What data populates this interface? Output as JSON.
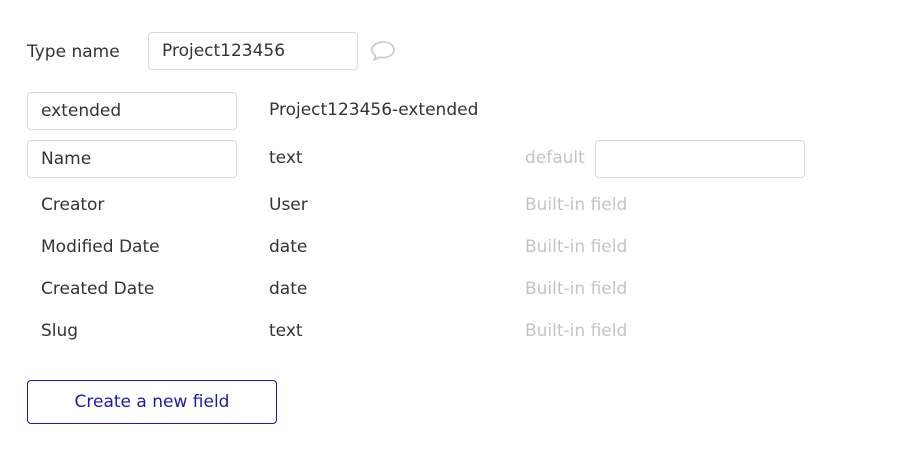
{
  "type_name": {
    "label": "Type name",
    "value": "Project123456"
  },
  "icons": {
    "comment": "speech-bubble-icon"
  },
  "extended": {
    "input_value": "extended",
    "result": "Project123456-extended"
  },
  "custom_field": {
    "name_value": "Name",
    "type": "text",
    "default_label": "default",
    "default_value": ""
  },
  "builtin_fields": [
    {
      "name": "Creator",
      "type": "User",
      "note": "Built-in field"
    },
    {
      "name": "Modified Date",
      "type": "date",
      "note": "Built-in field"
    },
    {
      "name": "Created Date",
      "type": "date",
      "note": "Built-in field"
    },
    {
      "name": "Slug",
      "type": "text",
      "note": "Built-in field"
    }
  ],
  "actions": {
    "create_field_label": "Create a new field"
  },
  "colors": {
    "accent": "#1a1ab3",
    "border": "#d9d9d9",
    "muted_text": "#c4c4c4",
    "text": "#333333"
  }
}
